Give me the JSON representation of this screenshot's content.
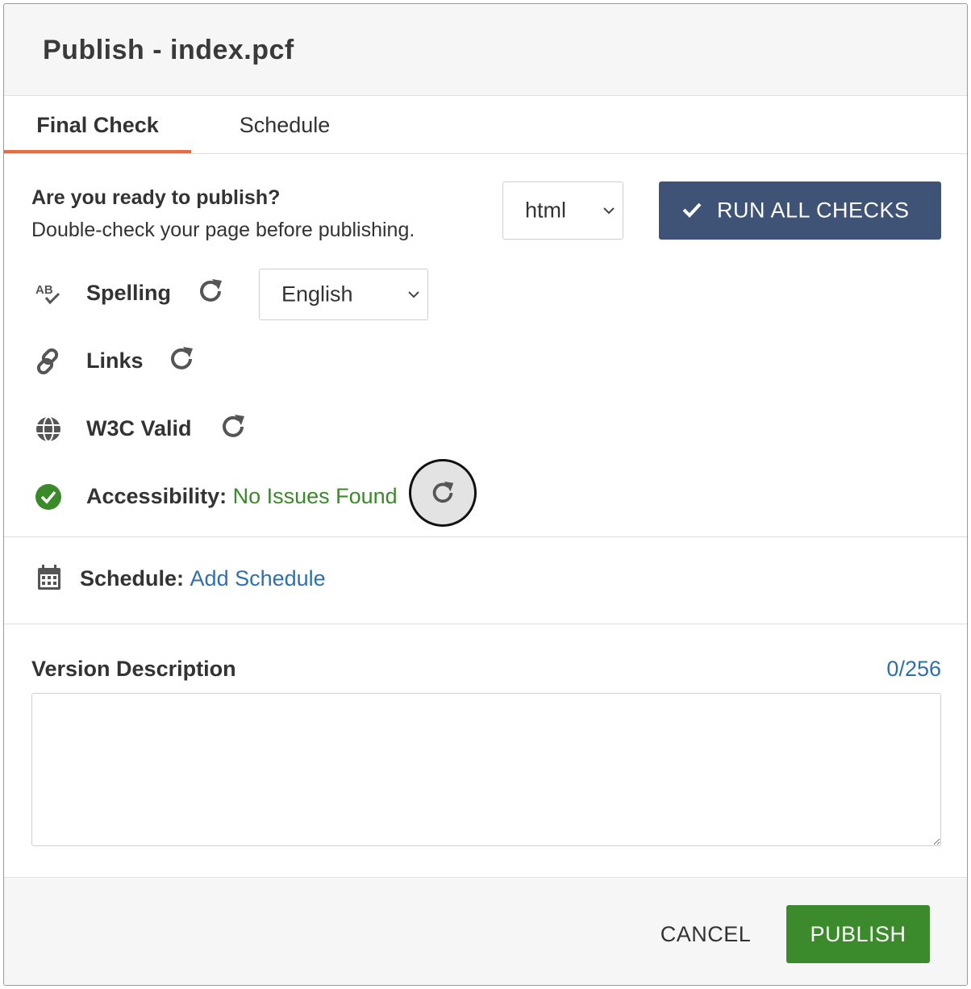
{
  "dialog": {
    "title": "Publish - index.pcf"
  },
  "tabs": [
    {
      "label": "Final Check",
      "active": true
    },
    {
      "label": "Schedule",
      "active": false
    }
  ],
  "ready": {
    "title": "Are you ready to publish?",
    "subtitle": "Double-check your page before publishing."
  },
  "format_select": {
    "value": "html"
  },
  "run_all": {
    "label": "RUN ALL CHECKS",
    "color": "#3e5375"
  },
  "checks": {
    "spelling": {
      "label": "Spelling",
      "icon": "spellcheck-icon",
      "language": "English"
    },
    "links": {
      "label": "Links",
      "icon": "link-icon"
    },
    "w3c": {
      "label": "W3C Valid",
      "icon": "globe-icon"
    },
    "accessibility": {
      "label": "Accessibility:",
      "status": "No Issues Found",
      "icon": "check-circle-icon",
      "status_color": "#3a8a2a"
    }
  },
  "schedule": {
    "label": "Schedule:",
    "link": "Add Schedule",
    "icon": "calendar-icon"
  },
  "version": {
    "label": "Version Description",
    "count": "0/256",
    "value": ""
  },
  "footer": {
    "cancel": "CANCEL",
    "publish": "PUBLISH",
    "publish_color": "#3b8a2b"
  }
}
